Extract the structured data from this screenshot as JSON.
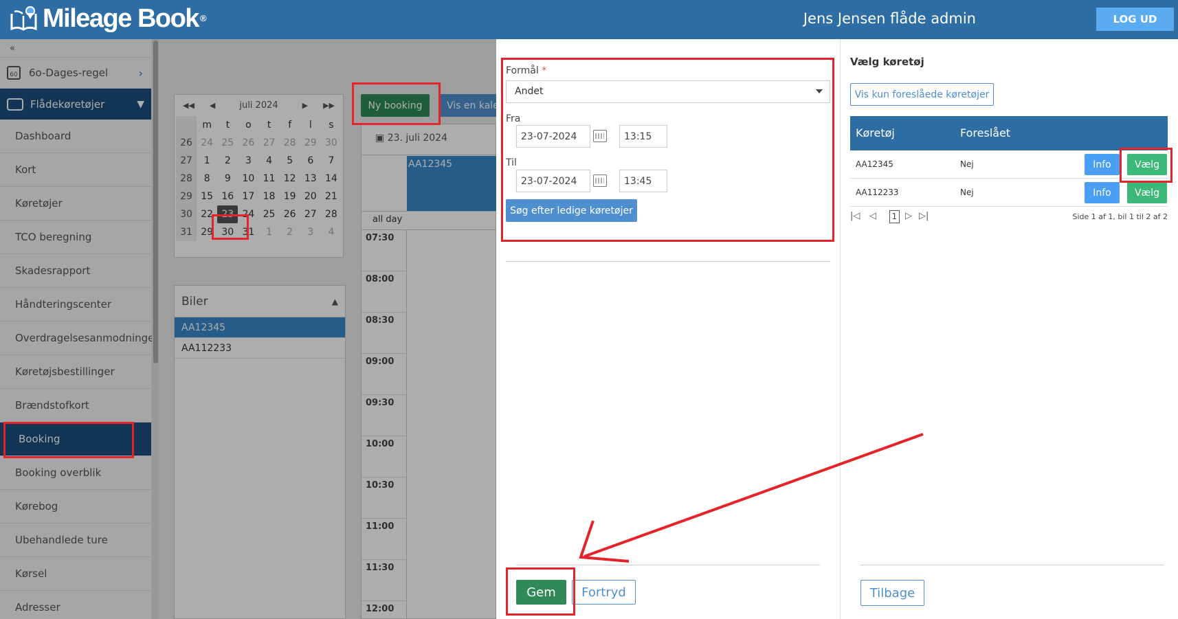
{
  "header": {
    "brand": "Mileage Book",
    "brand_reg": "®",
    "user": "Jens Jensen flåde admin",
    "logout": "LOG UD"
  },
  "sidebar": {
    "collapse": "«",
    "top_item": "6o-Dages-regel",
    "top_icon_text": "60",
    "group": "Flådekøretøjer",
    "items": [
      {
        "label": "Dashboard"
      },
      {
        "label": "Kort"
      },
      {
        "label": "Køretøjer"
      },
      {
        "label": "TCO beregning"
      },
      {
        "label": "Skadesrapport"
      },
      {
        "label": "Håndteringscenter"
      },
      {
        "label": "Overdragelsesanmodninger"
      },
      {
        "label": "Køretøjsbestillinger"
      },
      {
        "label": "Brændstofkort"
      },
      {
        "label": "Booking"
      },
      {
        "label": "Booking overblik"
      },
      {
        "label": "Kørebog"
      },
      {
        "label": "Ubehandlede ture"
      },
      {
        "label": "Kørsel"
      },
      {
        "label": "Adresser"
      }
    ]
  },
  "calendar": {
    "month": "juli 2024",
    "weekdays": [
      "m",
      "t",
      "o",
      "t",
      "f",
      "l",
      "s"
    ],
    "weeks": [
      [
        "26",
        "24",
        "25",
        "26",
        "27",
        "28",
        "29",
        "30"
      ],
      [
        "27",
        "1",
        "2",
        "3",
        "4",
        "5",
        "6",
        "7"
      ],
      [
        "28",
        "8",
        "9",
        "10",
        "11",
        "12",
        "13",
        "14"
      ],
      [
        "29",
        "15",
        "16",
        "17",
        "18",
        "19",
        "20",
        "21"
      ],
      [
        "30",
        "22",
        "23",
        "24",
        "25",
        "26",
        "27",
        "28"
      ],
      [
        "31",
        "29",
        "30",
        "31",
        "1",
        "2",
        "3",
        "4"
      ]
    ]
  },
  "biler": {
    "title": "Biler",
    "rows": [
      "AA12345",
      "AA112233"
    ]
  },
  "toolbar": {
    "ny_booking": "Ny booking",
    "vis_kalender": "Vis en kalender"
  },
  "dayview": {
    "date": "23. juli 2024",
    "event": "AA12345",
    "allday": "all day",
    "times": [
      "07:30",
      "08:00",
      "08:30",
      "09:00",
      "09:30",
      "10:00",
      "10:30",
      "11:00",
      "11:30",
      "12:00"
    ]
  },
  "form": {
    "formaal_label": "Formål",
    "required_mark": "*",
    "formaal_value": "Andet",
    "fra_label": "Fra",
    "fra_date": "23-07-2024",
    "fra_time": "13:15",
    "til_label": "Til",
    "til_date": "23-07-2024",
    "til_time": "13:45",
    "search_button": "Søg efter ledige køretøjer",
    "save_button": "Gem",
    "cancel_button": "Fortryd"
  },
  "vehicles": {
    "title": "Vælg køretøj",
    "filter_button": "Vis kun foreslåede køretøjer",
    "columns": [
      "Køretøj",
      "Foreslået"
    ],
    "rows": [
      {
        "vehicle": "AA12345",
        "suggested": "Nej",
        "info": "Info",
        "select": "Vælg"
      },
      {
        "vehicle": "AA112233",
        "suggested": "Nej",
        "info": "Info",
        "select": "Vælg"
      }
    ],
    "pager": {
      "page": "1",
      "info": "Side 1 af 1, bil 1 til 2 af 2"
    },
    "back_button": "Tilbage"
  },
  "colors": {
    "header": "#2e6da4",
    "nav_active": "#1d4e7e",
    "green": "#2e8b57",
    "annotation": "#e4232b"
  }
}
